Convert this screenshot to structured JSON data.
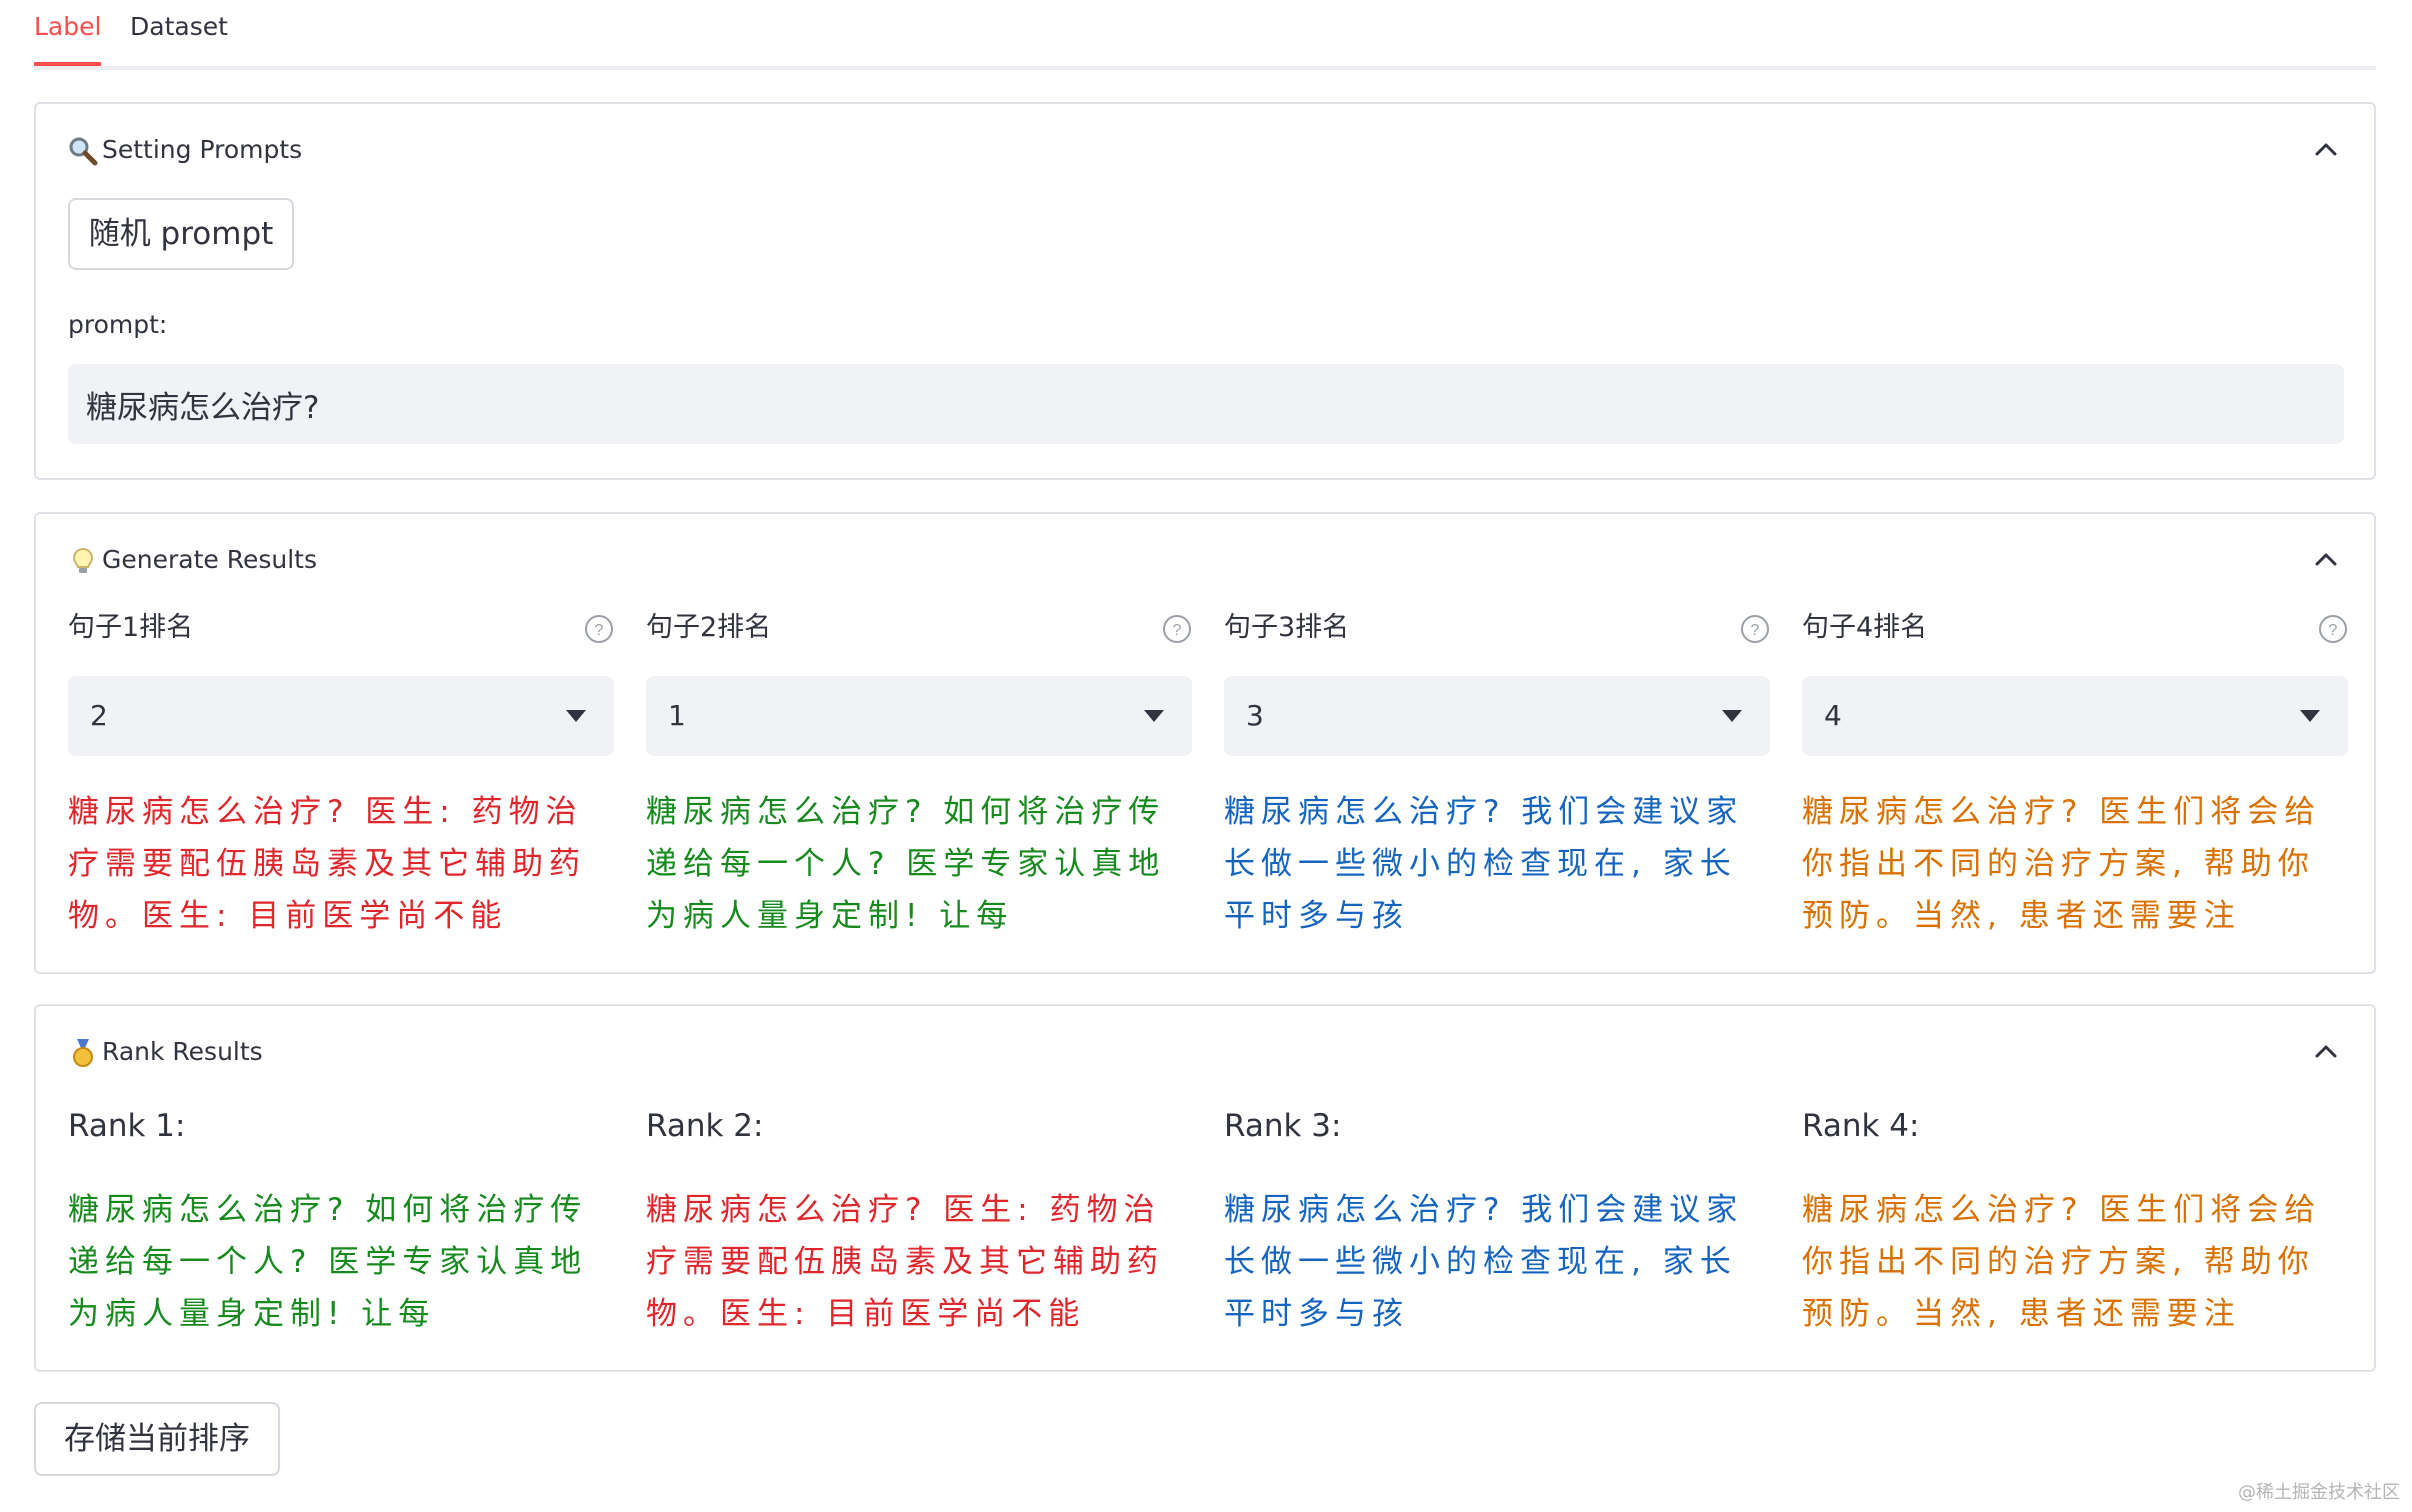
{
  "tabs": [
    {
      "label": "Label",
      "active": true
    },
    {
      "label": "Dataset",
      "active": false
    }
  ],
  "prompts_section": {
    "icon": "magnifier-icon",
    "title": "Setting Prompts",
    "random_button": "随机 prompt",
    "prompt_label": "prompt:",
    "prompt_value": "糖尿病怎么治疗?"
  },
  "generate_section": {
    "icon": "lightbulb-icon",
    "title": "Generate Results",
    "columns": [
      {
        "label": "句子1排名",
        "selected": "2",
        "text": "糖尿病怎么治疗? 医生: 药物治疗需要配伍胰岛素及其它辅助药物。医生: 目前医学尚不能",
        "color": "#e0252b"
      },
      {
        "label": "句子2排名",
        "selected": "1",
        "text": "糖尿病怎么治疗? 如何将治疗传递给每一个人? 医学专家认真地为病人量身定制! 让每",
        "color": "#168a1d"
      },
      {
        "label": "句子3排名",
        "selected": "3",
        "text": "糖尿病怎么治疗? 我们会建议家长做一些微小的检查现在, 家长平时多与孩",
        "color": "#1565c0"
      },
      {
        "label": "句子4排名",
        "selected": "4",
        "text": "糖尿病怎么治疗? 医生们将会给你指出不同的治疗方案, 帮助你预防。当然, 患者还需要注",
        "color": "#d97000"
      }
    ]
  },
  "rank_section": {
    "icon": "medal-icon",
    "title": "Rank Results",
    "columns": [
      {
        "label": "Rank 1:",
        "text": "糖尿病怎么治疗? 如何将治疗传递给每一个人? 医学专家认真地为病人量身定制! 让每",
        "color": "#168a1d"
      },
      {
        "label": "Rank 2:",
        "text": "糖尿病怎么治疗? 医生: 药物治疗需要配伍胰岛素及其它辅助药物。医生: 目前医学尚不能",
        "color": "#e0252b"
      },
      {
        "label": "Rank 3:",
        "text": "糖尿病怎么治疗? 我们会建议家长做一些微小的检查现在, 家长平时多与孩",
        "color": "#1565c0"
      },
      {
        "label": "Rank 4:",
        "text": "糖尿病怎么治疗? 医生们将会给你指出不同的治疗方案, 帮助你预防。当然, 患者还需要注",
        "color": "#d97000"
      }
    ]
  },
  "save_button": "存储当前排序",
  "watermark": "@稀土掘金技术社区"
}
